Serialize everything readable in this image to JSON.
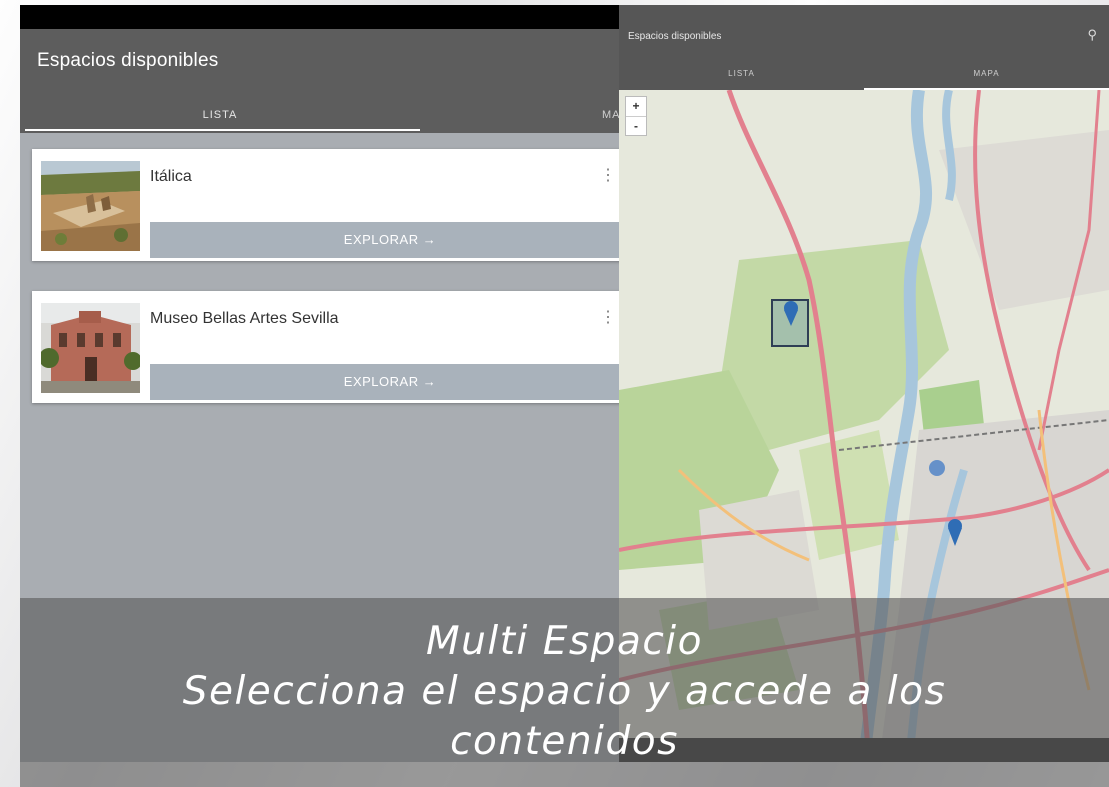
{
  "left_screen": {
    "app_title": "Espacios disponibles",
    "tabs": [
      {
        "label": "LISTA",
        "active": true
      },
      {
        "label": "MA",
        "active": false
      }
    ],
    "cards": [
      {
        "title": "Itálica",
        "action": "EXPLORAR →",
        "menu": "⋮",
        "thumb_icon": "italica-ruins-photo"
      },
      {
        "title": "Museo Bellas Artes Sevilla",
        "action": "EXPLORAR →",
        "menu": "⋮",
        "thumb_icon": "museum-facade-photo"
      }
    ]
  },
  "right_screen": {
    "app_title": "Espacios disponibles",
    "search_icon": "search-icon",
    "tabs": [
      {
        "label": "LISTA",
        "active": false
      },
      {
        "label": "MAPA",
        "active": true
      }
    ],
    "map": {
      "zoom_in": "+",
      "zoom_out": "-",
      "markers": 3
    }
  },
  "caption": {
    "line1": "Multi Espacio",
    "line2": "Selecciona el espacio y accede a los",
    "line3": "contenidos"
  },
  "colors": {
    "app_bar": "#5d5d5d",
    "list_background": "#a9adb2",
    "explore_button": "#a9b2bb",
    "marker": "#2f6db5"
  }
}
